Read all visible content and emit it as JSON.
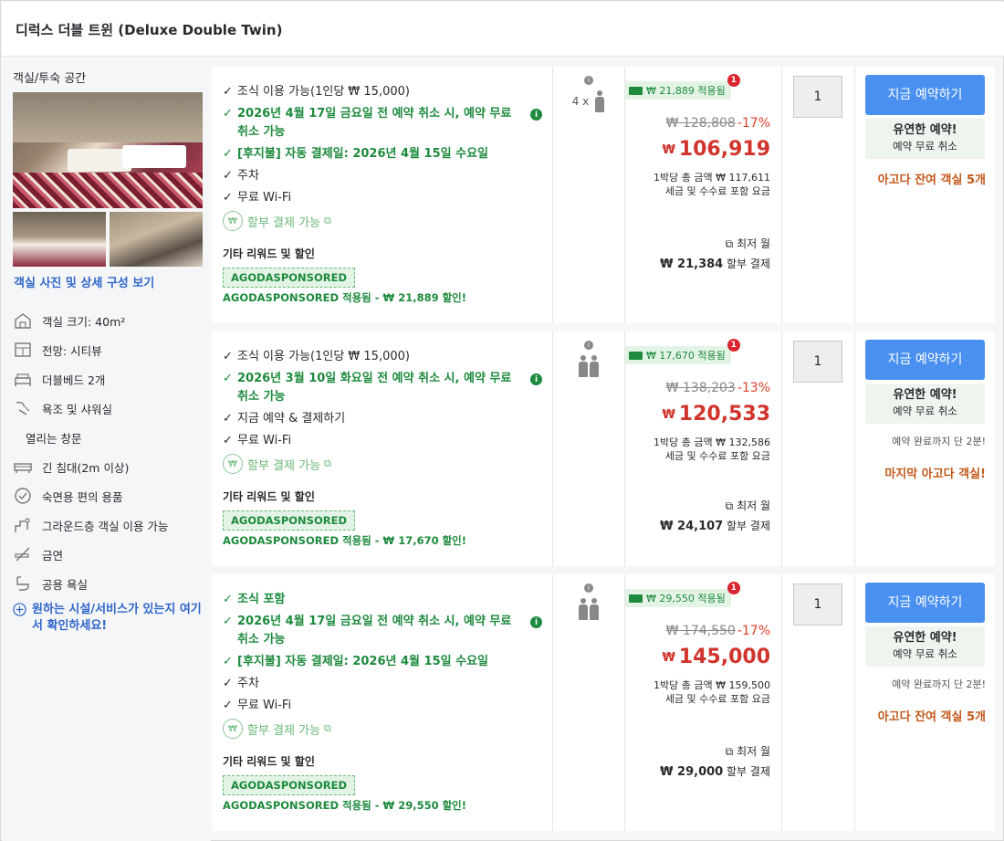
{
  "header": {
    "title": "디럭스 더블 트윈 (Deluxe Double Twin)"
  },
  "sidebar": {
    "section_title": "객실/투숙 공간",
    "photos_link": "객실 사진 및 상세 구성 보기",
    "amenities": [
      {
        "icon": "house-icon",
        "label": "객실 크기: 40m²"
      },
      {
        "icon": "window-icon",
        "label": "전망: 시티뷰"
      },
      {
        "icon": "bed-icon",
        "label": "더블베드 2개"
      },
      {
        "icon": "shower-icon",
        "label": "욕조 및 샤워실"
      },
      {
        "icon": "",
        "label": "열리는 창문"
      },
      {
        "icon": "long-bed-icon",
        "label": "긴 침대(2m 이상)"
      },
      {
        "icon": "check-circle-icon",
        "label": "숙면용 편의 용품"
      },
      {
        "icon": "ground-floor-icon",
        "label": "그라운드층 객실 이용 가능"
      },
      {
        "icon": "no-smoking-icon",
        "label": "금연"
      },
      {
        "icon": "shared-bath-icon",
        "label": "공용 욕실"
      }
    ],
    "more_link": "원하는 시설/서비스가 있는지 여기서 확인하세요!"
  },
  "rows": [
    {
      "features": [
        {
          "text": "조식 이용 가능(1인당 ₩ 15,000)",
          "green": false
        },
        {
          "text": "2026년 4월 17일 금요일 전 예약 취소 시, 예약 무료 취소 가능",
          "green": true,
          "info": true
        },
        {
          "text": "[후지불] 자동 결제일: 2026년 4월 15일 수요일",
          "green": true
        },
        {
          "text": "주차",
          "green": false
        },
        {
          "text": "무료 Wi-Fi",
          "green": false
        }
      ],
      "installment": "할부 결제 가능",
      "rewards_title": "기타 리워드 및 할인",
      "sponsored_tag": "AGODASPONSORED",
      "sponsored_text": "AGODASPONSORED 적용됨 - ₩ 21,889 할인!",
      "occupancy": "4 x",
      "deal_badge": "₩ 21,889 적용됨",
      "deal_count": "1",
      "original_price": "₩ 128,808",
      "discount": "-17%",
      "currency": "₩",
      "price": "106,919",
      "per_night_line1": "1박당 총 금액 ₩ 117,611",
      "per_night_line2": "세금 및 수수료 포함 요금",
      "monthly_label": "최저 월",
      "monthly_amount": "₩ 21,384",
      "monthly_suffix": "할부 결제",
      "qty": "1",
      "book_label": "지금 예약하기",
      "flex_title": "유연한 예약!",
      "flex_sub": "예약 무료 취소",
      "urgency_note": "",
      "urgency": "아고다 잔여 객실 5개"
    },
    {
      "features": [
        {
          "text": "조식 이용 가능(1인당 ₩ 15,000)",
          "green": false
        },
        {
          "text": "2026년 3월 10일 화요일 전 예약 취소 시, 예약 무료 취소 가능",
          "green": true,
          "info": true
        },
        {
          "text": "지금 예약 & 결제하기",
          "green": false
        },
        {
          "text": "무료 Wi-Fi",
          "green": false
        }
      ],
      "installment": "할부 결제 가능",
      "rewards_title": "기타 리워드 및 할인",
      "sponsored_tag": "AGODASPONSORED",
      "sponsored_text": "AGODASPONSORED 적용됨 - ₩ 17,670 할인!",
      "occupancy": "",
      "deal_badge": "₩ 17,670 적용됨",
      "deal_count": "1",
      "original_price": "₩ 138,203",
      "discount": "-13%",
      "currency": "₩",
      "price": "120,533",
      "per_night_line1": "1박당 총 금액 ₩ 132,586",
      "per_night_line2": "세금 및 수수료 포함 요금",
      "monthly_label": "최저 월",
      "monthly_amount": "₩ 24,107",
      "monthly_suffix": "할부 결제",
      "qty": "1",
      "book_label": "지금 예약하기",
      "flex_title": "유연한 예약!",
      "flex_sub": "예약 무료 취소",
      "urgency_note": "예약 완료까지 단 2분!",
      "urgency": "마지막 아고다 객실!"
    },
    {
      "features": [
        {
          "text": "조식 포함",
          "green": true
        },
        {
          "text": "2026년 4월 17일 금요일 전 예약 취소 시, 예약 무료 취소 가능",
          "green": true,
          "info": true
        },
        {
          "text": "[후지불] 자동 결제일: 2026년 4월 15일 수요일",
          "green": true
        },
        {
          "text": "주차",
          "green": false
        },
        {
          "text": "무료 Wi-Fi",
          "green": false
        }
      ],
      "installment": "할부 결제 가능",
      "rewards_title": "기타 리워드 및 할인",
      "sponsored_tag": "AGODASPONSORED",
      "sponsored_text": "AGODASPONSORED 적용됨 - ₩ 29,550 할인!",
      "occupancy": "",
      "deal_badge": "₩ 29,550 적용됨",
      "deal_count": "1",
      "original_price": "₩ 174,550",
      "discount": "-17%",
      "currency": "₩",
      "price": "145,000",
      "per_night_line1": "1박당 총 금액 ₩ 159,500",
      "per_night_line2": "세금 및 수수료 포함 요금",
      "monthly_label": "최저 월",
      "monthly_amount": "₩ 29,000",
      "monthly_suffix": "할부 결제",
      "qty": "1",
      "book_label": "지금 예약하기",
      "flex_title": "유연한 예약!",
      "flex_sub": "예약 무료 취소",
      "urgency_note": "예약 완료까지 단 2분!",
      "urgency": "아고다 잔여 객실 5개"
    }
  ]
}
